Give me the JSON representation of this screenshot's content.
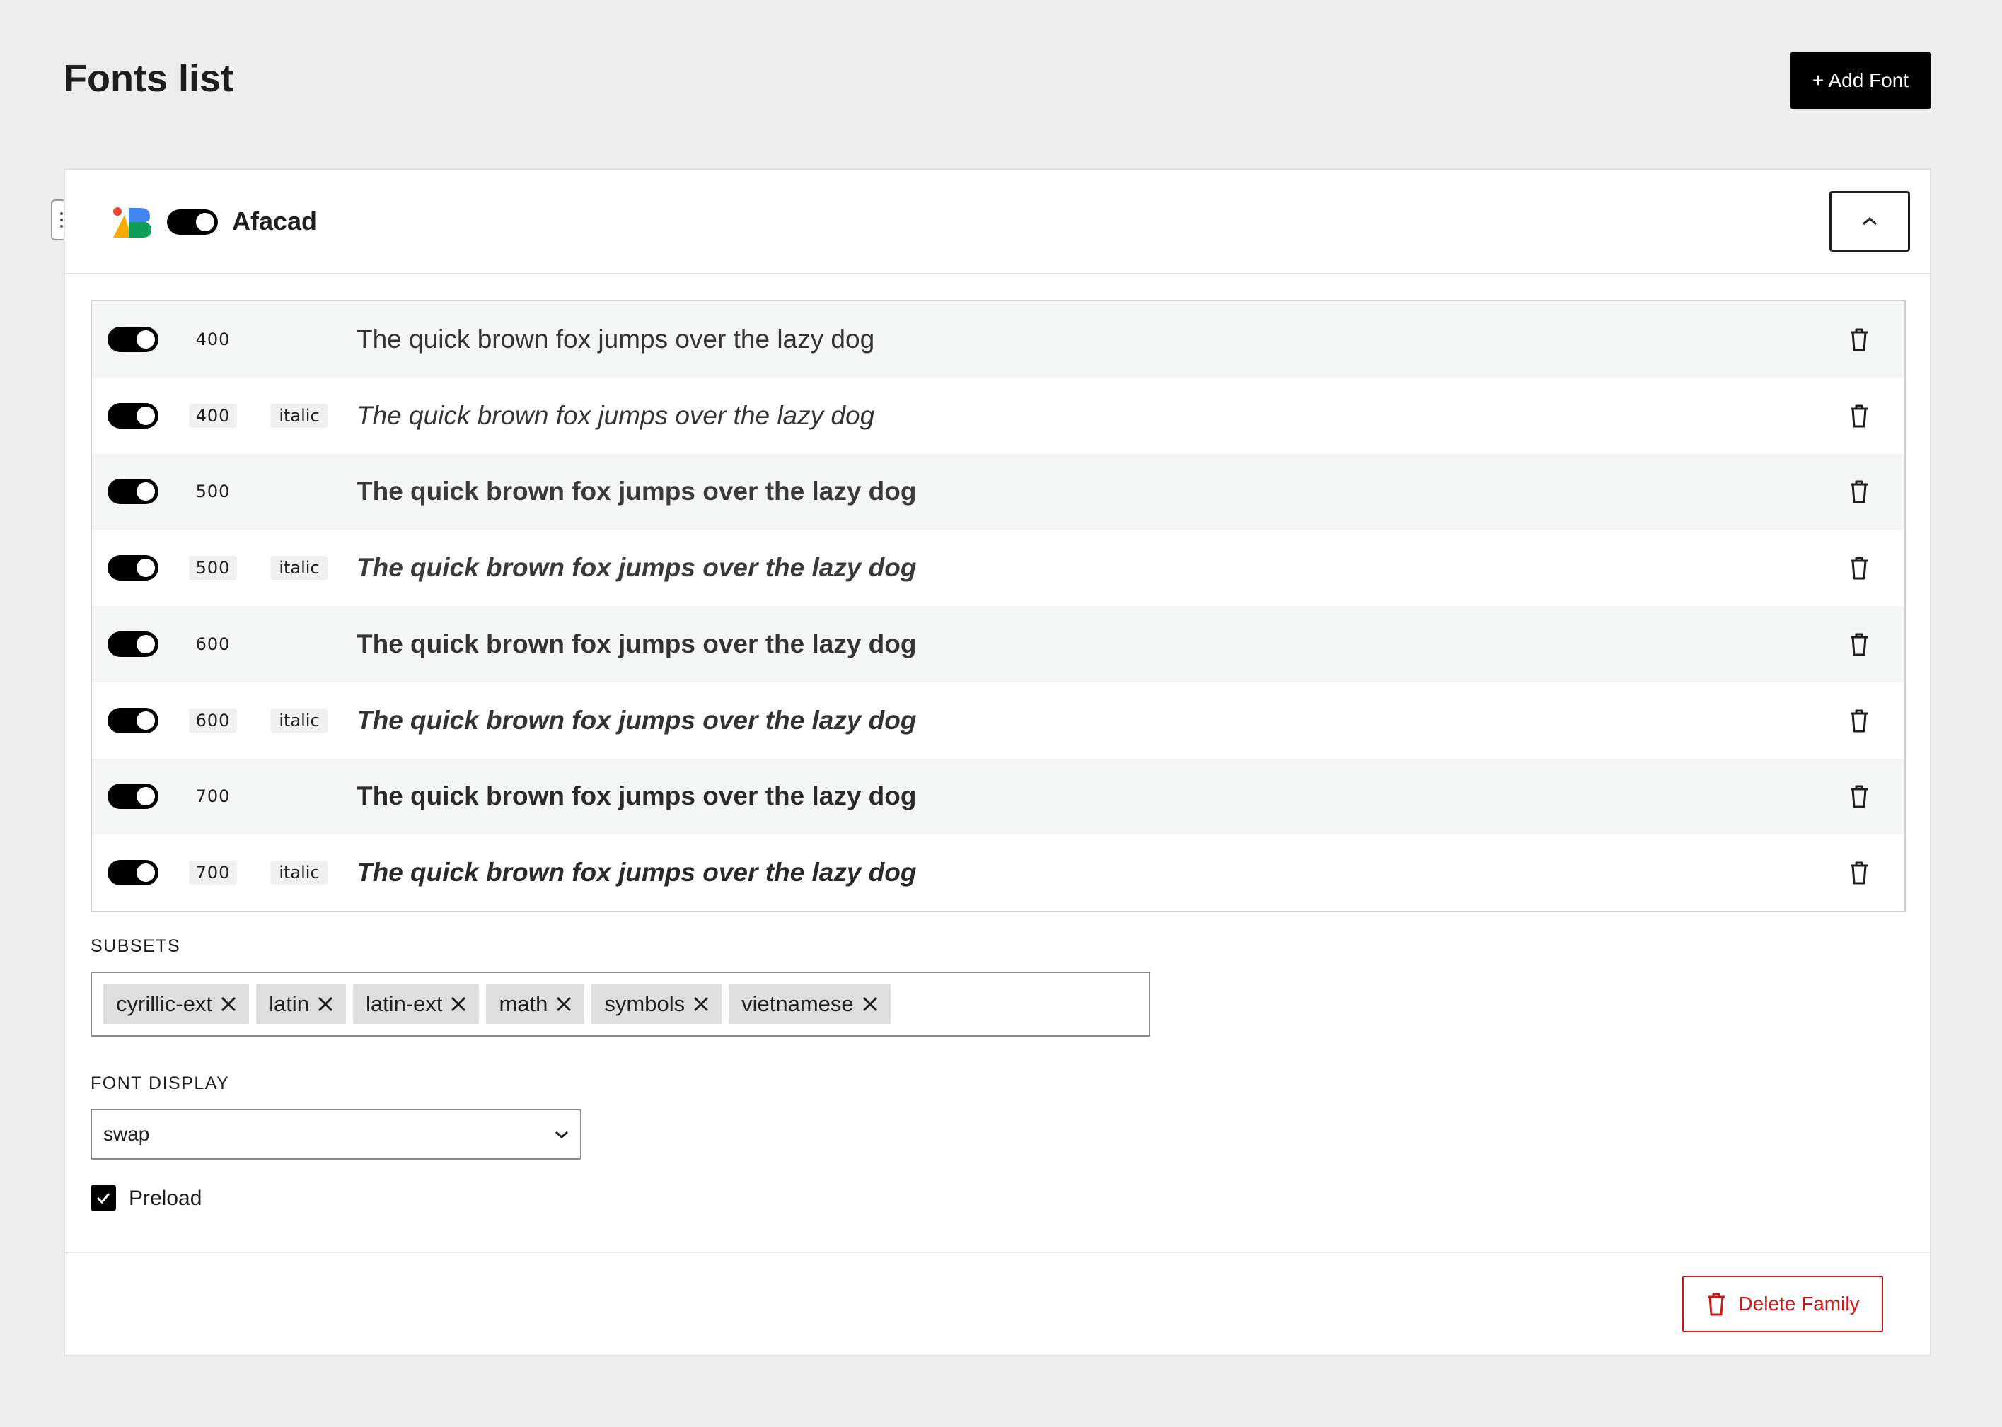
{
  "header": {
    "title": "Fonts list",
    "add_font_label": "+ Add Font"
  },
  "family": {
    "name": "Afacad",
    "enabled": true,
    "variants": [
      {
        "weight": "400",
        "style": "",
        "preview": "The quick brown fox jumps over the lazy dog",
        "enabled": true
      },
      {
        "weight": "400",
        "style": "italic",
        "preview": "The quick brown fox jumps over the lazy dog",
        "enabled": true
      },
      {
        "weight": "500",
        "style": "",
        "preview": "The quick brown fox jumps over the lazy dog",
        "enabled": true
      },
      {
        "weight": "500",
        "style": "italic",
        "preview": "The quick brown fox jumps over the lazy dog",
        "enabled": true
      },
      {
        "weight": "600",
        "style": "",
        "preview": "The quick brown fox jumps over the lazy dog",
        "enabled": true
      },
      {
        "weight": "600",
        "style": "italic",
        "preview": "The quick brown fox jumps over the lazy dog",
        "enabled": true
      },
      {
        "weight": "700",
        "style": "",
        "preview": "The quick brown fox jumps over the lazy dog",
        "enabled": true
      },
      {
        "weight": "700",
        "style": "italic",
        "preview": "The quick brown fox jumps over the lazy dog",
        "enabled": true
      }
    ],
    "subsets_label": "SUBSETS",
    "subsets": [
      "cyrillic-ext",
      "latin",
      "latin-ext",
      "math",
      "symbols",
      "vietnamese"
    ],
    "font_display_label": "FONT DISPLAY",
    "font_display_value": "swap",
    "preload_label": "Preload",
    "preload_checked": true,
    "delete_family_label": "Delete Family"
  },
  "colors": {
    "accent": "#000000",
    "danger": "#cc1818",
    "background": "#ededed"
  }
}
